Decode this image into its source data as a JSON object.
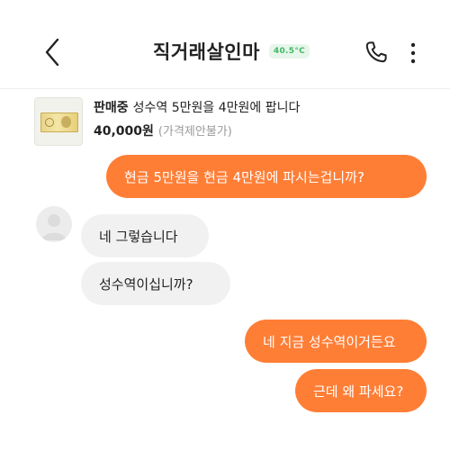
{
  "header": {
    "title": "직거래살인마",
    "temperature": "40.5°C",
    "icons": {
      "back": "chevron-left-icon",
      "call": "phone-icon",
      "more": "more-vertical-icon"
    }
  },
  "product": {
    "status": "판매중",
    "name": "성수역 5만원을 4만원에 팝니다",
    "price": "40,000원",
    "price_note": "(가격제안불가)"
  },
  "messages": [
    {
      "side": "out",
      "text": "현금 5만원을 현금 4만원에 파시는겁니까?"
    },
    {
      "side": "in",
      "text": "네 그렇습니다"
    },
    {
      "side": "in",
      "text": "성수역이십니까?"
    },
    {
      "side": "out",
      "text": "네 지금 성수역이거든요"
    },
    {
      "side": "out",
      "text": "근데 왜 파세요?"
    }
  ],
  "colors": {
    "accent": "#ff7e36",
    "incoming_bubble": "#f1f1f1",
    "temperature_green": "#41b863"
  }
}
